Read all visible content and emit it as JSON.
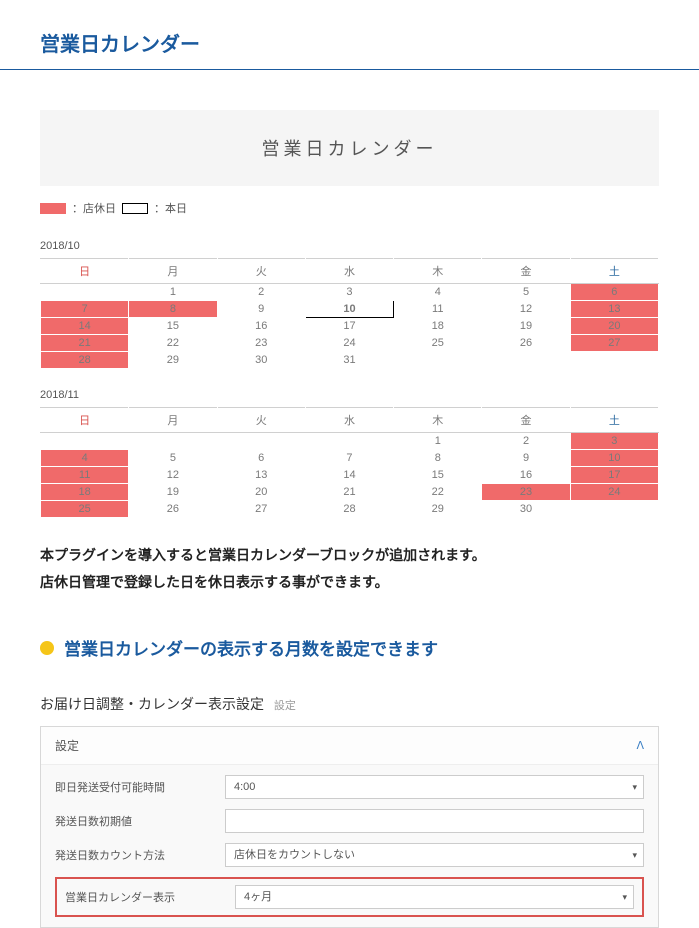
{
  "page_title": "営業日カレンダー",
  "block_title": "営業日カレンダー",
  "legend": {
    "holiday": "：店休日",
    "today": "：本日"
  },
  "weekdays": [
    "日",
    "月",
    "火",
    "水",
    "木",
    "金",
    "土"
  ],
  "calendars": [
    {
      "label": "2018/10",
      "weeks": [
        [
          {
            "v": ""
          },
          {
            "v": "1"
          },
          {
            "v": "2"
          },
          {
            "v": "3"
          },
          {
            "v": "4"
          },
          {
            "v": "5"
          },
          {
            "v": "6",
            "h": true
          }
        ],
        [
          {
            "v": "7",
            "h": true
          },
          {
            "v": "8",
            "h": true
          },
          {
            "v": "9"
          },
          {
            "v": "10",
            "t": true
          },
          {
            "v": "11"
          },
          {
            "v": "12"
          },
          {
            "v": "13",
            "h": true
          }
        ],
        [
          {
            "v": "14",
            "h": true
          },
          {
            "v": "15"
          },
          {
            "v": "16"
          },
          {
            "v": "17"
          },
          {
            "v": "18"
          },
          {
            "v": "19"
          },
          {
            "v": "20",
            "h": true
          }
        ],
        [
          {
            "v": "21",
            "h": true
          },
          {
            "v": "22"
          },
          {
            "v": "23"
          },
          {
            "v": "24"
          },
          {
            "v": "25"
          },
          {
            "v": "26"
          },
          {
            "v": "27",
            "h": true
          }
        ],
        [
          {
            "v": "28",
            "h": true
          },
          {
            "v": "29"
          },
          {
            "v": "30"
          },
          {
            "v": "31"
          },
          {
            "v": ""
          },
          {
            "v": ""
          },
          {
            "v": ""
          }
        ]
      ]
    },
    {
      "label": "2018/11",
      "weeks": [
        [
          {
            "v": ""
          },
          {
            "v": ""
          },
          {
            "v": ""
          },
          {
            "v": ""
          },
          {
            "v": "1"
          },
          {
            "v": "2"
          },
          {
            "v": "3",
            "h": true
          }
        ],
        [
          {
            "v": "4",
            "h": true
          },
          {
            "v": "5"
          },
          {
            "v": "6"
          },
          {
            "v": "7"
          },
          {
            "v": "8"
          },
          {
            "v": "9"
          },
          {
            "v": "10",
            "h": true
          }
        ],
        [
          {
            "v": "11",
            "h": true
          },
          {
            "v": "12"
          },
          {
            "v": "13"
          },
          {
            "v": "14"
          },
          {
            "v": "15"
          },
          {
            "v": "16"
          },
          {
            "v": "17",
            "h": true
          }
        ],
        [
          {
            "v": "18",
            "h": true
          },
          {
            "v": "19"
          },
          {
            "v": "20"
          },
          {
            "v": "21"
          },
          {
            "v": "22"
          },
          {
            "v": "23",
            "h": true
          },
          {
            "v": "24",
            "h": true
          }
        ],
        [
          {
            "v": "25",
            "h": true
          },
          {
            "v": "26"
          },
          {
            "v": "27"
          },
          {
            "v": "28"
          },
          {
            "v": "29"
          },
          {
            "v": "30"
          },
          {
            "v": ""
          }
        ]
      ]
    }
  ],
  "description_l1": "本プラグインを導入すると営業日カレンダーブロックが追加されます。",
  "description_l2": "店休日管理で登録した日を休日表示する事ができます。",
  "section_heading": "営業日カレンダーの表示する月数を設定できます",
  "settings": {
    "title": "お届け日調整・カレンダー表示設定",
    "title_sub": "設定",
    "header": "設定",
    "rows": [
      {
        "label": "即日発送受付可能時間",
        "type": "select",
        "value": "4:00"
      },
      {
        "label": "発送日数初期値",
        "type": "text",
        "value": ""
      },
      {
        "label": "発送日数カウント方法",
        "type": "select",
        "value": "店休日をカウントしない"
      },
      {
        "label": "営業日カレンダー表示",
        "type": "select",
        "value": "4ヶ月",
        "highlighted": true
      }
    ]
  }
}
